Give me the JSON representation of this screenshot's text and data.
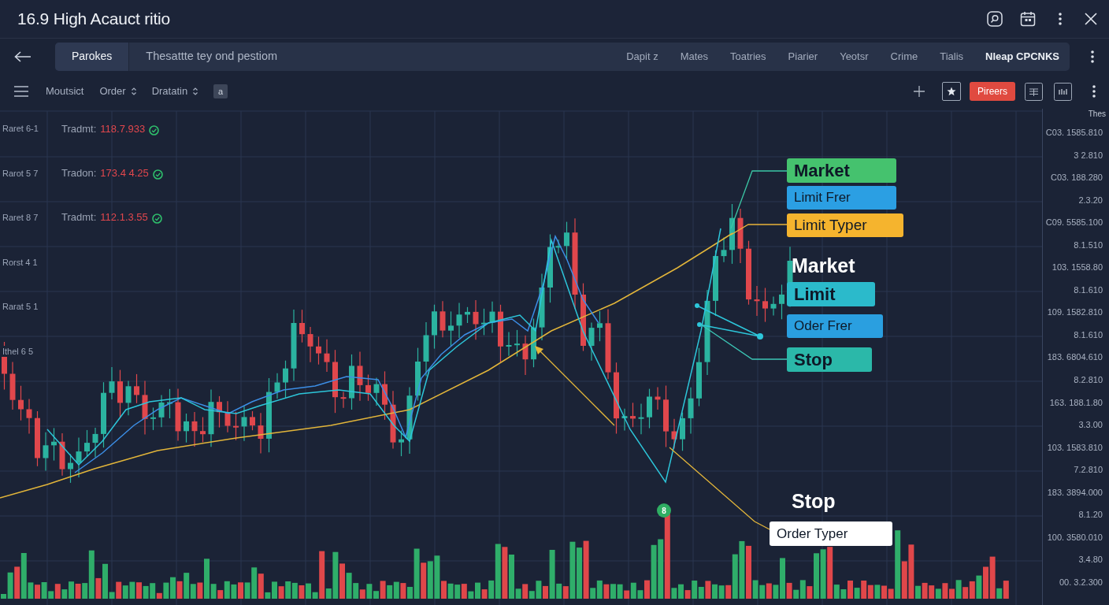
{
  "window": {
    "title": "16.9 High Acauct ritio"
  },
  "nav": {
    "tabs": [
      {
        "label": "Parokes",
        "selected": true
      }
    ],
    "description": "Thesattte tey ond pestiom",
    "links": [
      {
        "label": "Dapit z",
        "selected": false
      },
      {
        "label": "Mates",
        "selected": false
      },
      {
        "label": "Toatries",
        "selected": false
      },
      {
        "label": "Piarier",
        "selected": false
      },
      {
        "label": "Yeotsr",
        "selected": false
      },
      {
        "label": "Crime",
        "selected": false
      },
      {
        "label": "Tialis",
        "selected": false
      },
      {
        "label": "Nleap CPCNKS",
        "selected": true
      }
    ]
  },
  "toolbar": {
    "menus": [
      {
        "label": "Moutsict",
        "dropdown": false
      },
      {
        "label": "Order",
        "dropdown": true
      },
      {
        "label": "Dratatin",
        "dropdown": true
      }
    ],
    "tag": "a",
    "action_button": "Pireers"
  },
  "chart": {
    "row_labels": [
      "Raret 6-1",
      "Rarot 5 7",
      "Raret 8 7",
      "Rorst 4 1",
      "Rarat 5 1",
      "Ithel 6 5"
    ],
    "trades": [
      {
        "label": "Tradmt:",
        "value": "118.7.933"
      },
      {
        "label": "Tradon:",
        "value": "173.4 4.25"
      },
      {
        "label": "Tradmt:",
        "value": "112.1.3.55"
      }
    ],
    "axis_title": "Thes",
    "axis_labels": [
      "C03. 1585.810",
      "3 2.810",
      "C03. 188.280",
      "2.3.20",
      "C09. 5585.100",
      "8.1.510",
      "103. 1558.80",
      "8.1.610",
      "109. 1582.810",
      "8.1.610",
      "183. 6804.610",
      "8.2.810",
      "163. 188.1.80",
      "3.3.00",
      "103. 1583.810",
      "7.2.810",
      "183. 3894.000",
      "8.1.20",
      "100. 3580.010",
      "3.4.80",
      "00. 3.2.300"
    ],
    "annotations": [
      {
        "text": "Market",
        "kind": "tag",
        "color": "#45c26e"
      },
      {
        "text": "Limit Frer",
        "kind": "tag",
        "color": "#2b9fe3"
      },
      {
        "text": "Limit Typer",
        "kind": "tag",
        "color": "#f5b42e"
      },
      {
        "text": "Market",
        "kind": "plain"
      },
      {
        "text": "Limit",
        "kind": "tag",
        "color": "#2bbacb"
      },
      {
        "text": "Oder Frer",
        "kind": "tag",
        "color": "#2a9fe0"
      },
      {
        "text": "Stop",
        "kind": "tag",
        "color": "#2bb8a9"
      },
      {
        "text": "Stop",
        "kind": "plain"
      },
      {
        "text": "Order Typer",
        "kind": "tag",
        "color": "#ffffff"
      }
    ],
    "marker": "8"
  }
}
